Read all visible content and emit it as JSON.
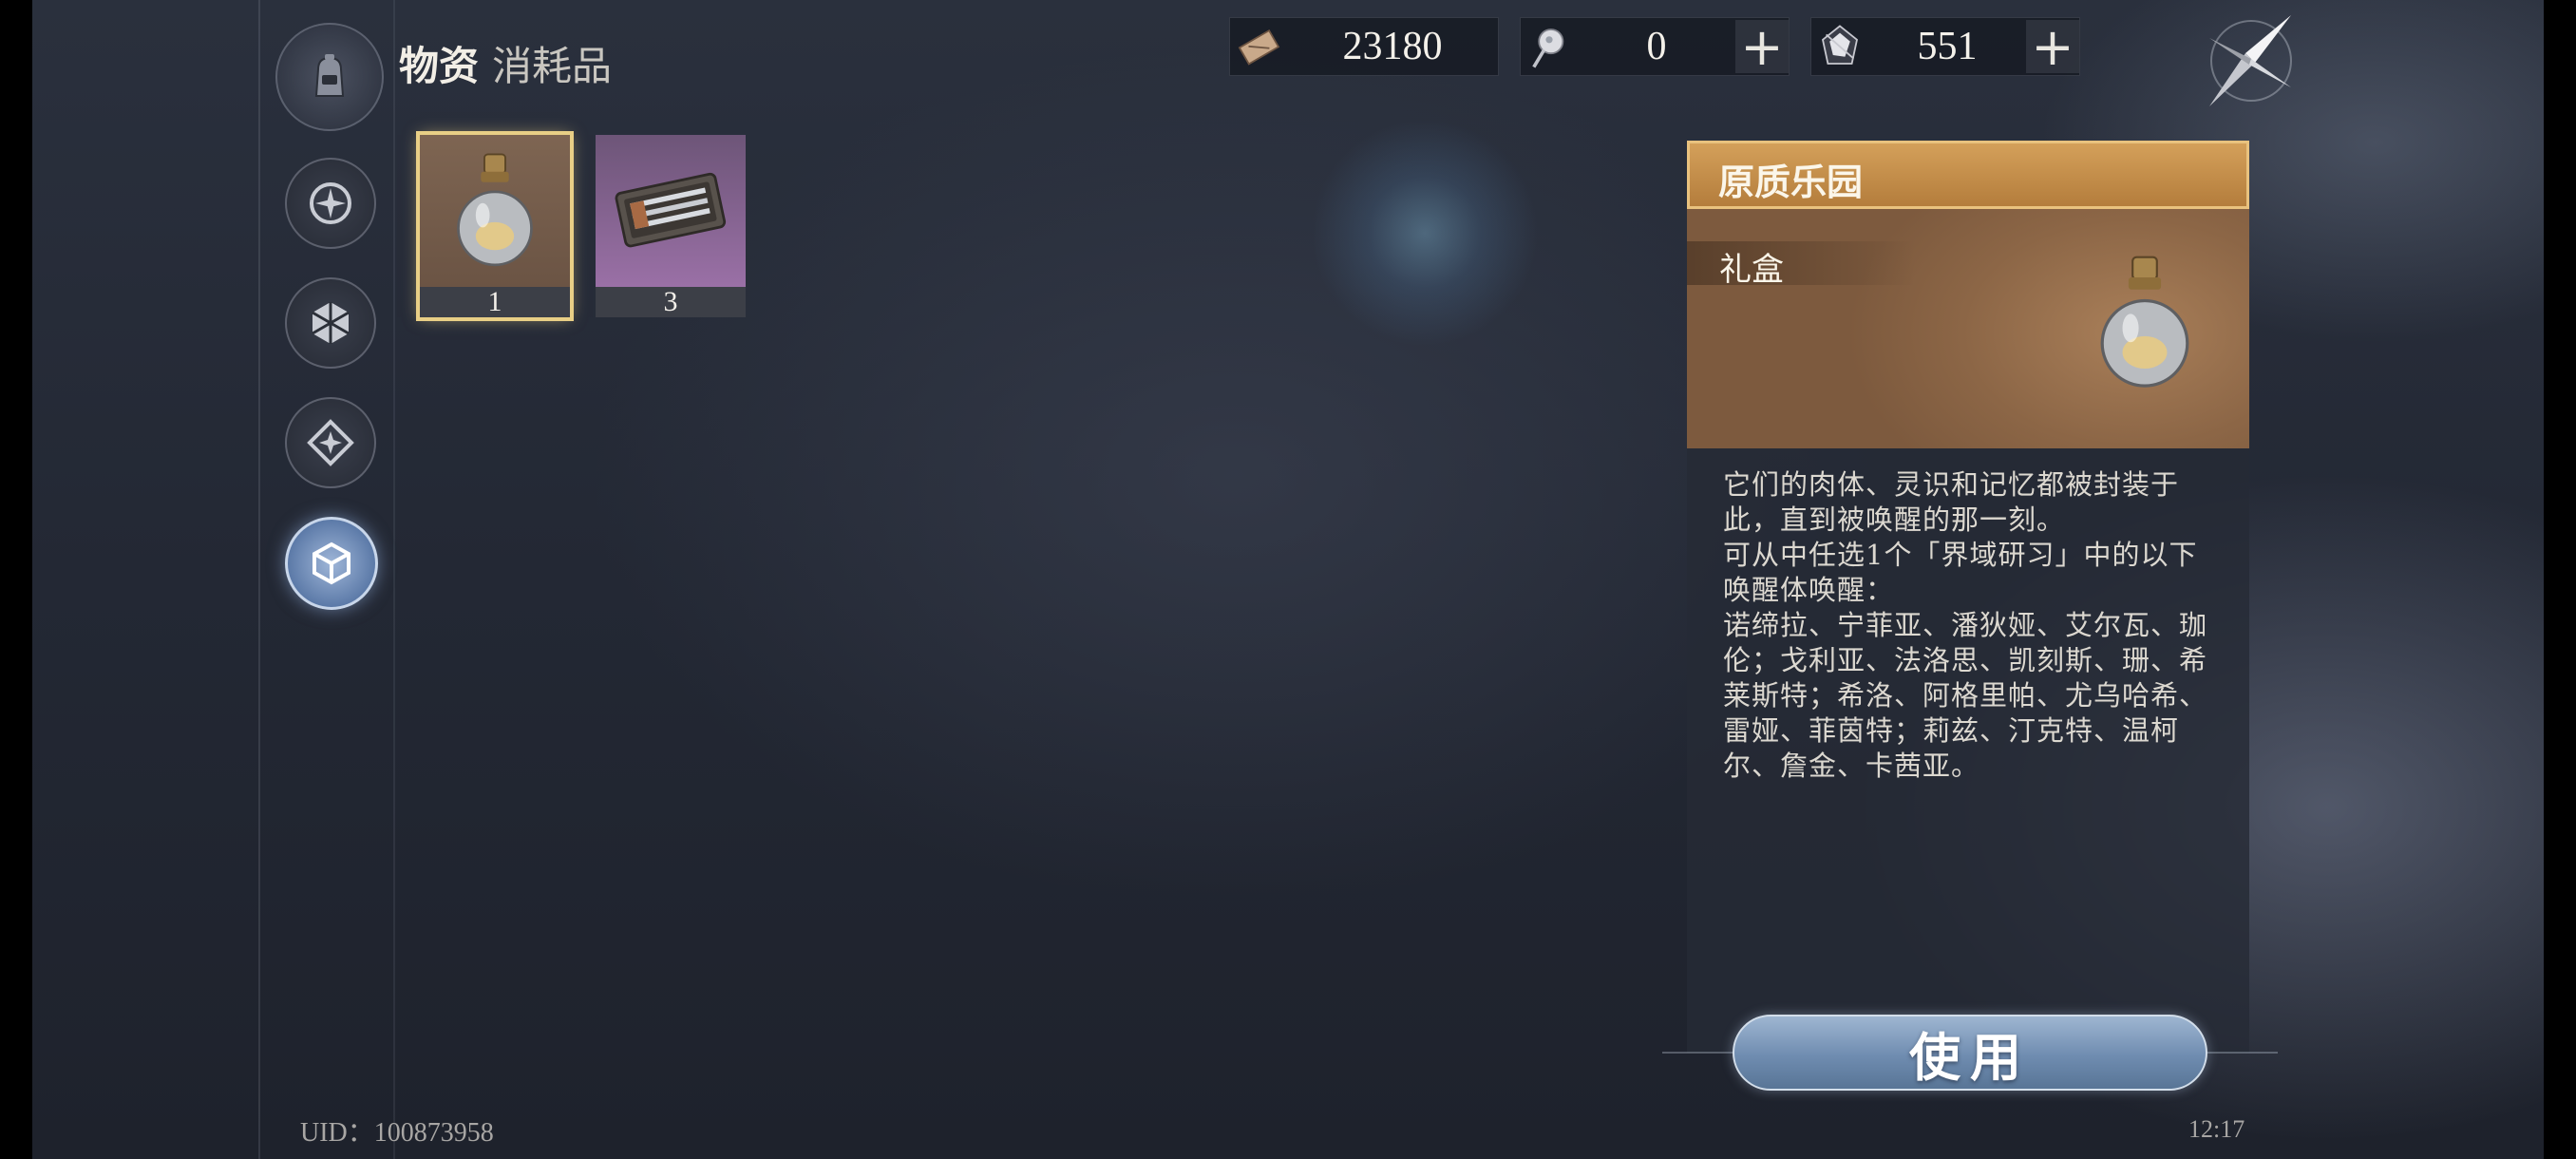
{
  "header": {
    "title": "物资",
    "subtitle": "消耗品"
  },
  "currencies": [
    {
      "icon": "ticket-icon",
      "value": "23180",
      "has_plus": false
    },
    {
      "icon": "orb-key-icon",
      "value": "0",
      "has_plus": true,
      "plus_label": "+"
    },
    {
      "icon": "crystal-icon",
      "value": "551",
      "has_plus": true,
      "plus_label": "+"
    }
  ],
  "nav": [
    {
      "name": "nav-all",
      "icon": "compass-rose-icon",
      "active": false
    },
    {
      "name": "nav-material",
      "icon": "hexagon-shard-icon",
      "active": false
    },
    {
      "name": "nav-upgrade",
      "icon": "diamond-star-icon",
      "active": false
    },
    {
      "name": "nav-consumable",
      "icon": "cube-icon",
      "active": true
    }
  ],
  "inventory": [
    {
      "icon": "flask-bottle-icon",
      "count": "1",
      "rarity_color": "#7e6552",
      "selected": true
    },
    {
      "icon": "tool-case-icon",
      "count": "3",
      "rarity_color": "#9a70a6",
      "selected": false
    }
  ],
  "detail": {
    "name": "原质乐园",
    "type": "礼盒",
    "header_color": "#c99250",
    "description": [
      "它们的肉体、灵识和记忆都被封装于此，直到被唤醒的那一刻。",
      "可从中任选1个「界域研习」中的以下唤醒体唤醒：",
      "诺缔拉、宁菲亚、潘狄娅、艾尔瓦、珈伦；戈利亚、法洛思、凯刻斯、珊、希莱斯特；希洛、阿格里帕、尤乌哈希、雷娅、菲茵特；莉兹、汀克特、温柯尔、詹金、卡茜亚。"
    ],
    "use_label": "使用"
  },
  "footer": {
    "uid": "UID：100873958",
    "time": "12:17"
  }
}
